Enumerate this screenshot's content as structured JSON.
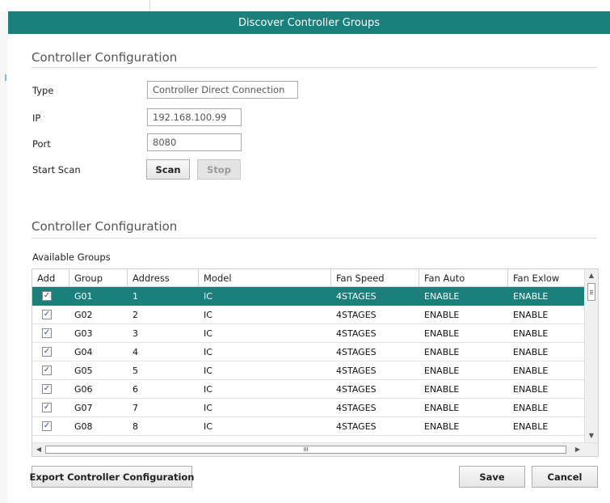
{
  "dialog": {
    "title": "Discover Controller Groups"
  },
  "config_section": {
    "title": "Controller Configuration",
    "type_label": "Type",
    "type_value": "Controller Direct Connection",
    "ip_label": "IP",
    "ip_value": "192.168.100.99",
    "port_label": "Port",
    "port_value": "8080",
    "scan_label": "Start Scan",
    "scan_button": "Scan",
    "stop_button": "Stop"
  },
  "groups_section": {
    "title": "Controller Configuration",
    "available_label": "Available Groups",
    "columns": [
      "Add",
      "Group",
      "Address",
      "Model",
      "Fan Speed",
      "Fan Auto",
      "Fan Exlow"
    ],
    "rows": [
      {
        "add": "✓",
        "group": "G01",
        "address": "1",
        "model": "IC",
        "fan_speed": "4STAGES",
        "fan_auto": "ENABLE",
        "fan_exlow": "ENABLE"
      },
      {
        "add": "✓",
        "group": "G02",
        "address": "2",
        "model": "IC",
        "fan_speed": "4STAGES",
        "fan_auto": "ENABLE",
        "fan_exlow": "ENABLE"
      },
      {
        "add": "✓",
        "group": "G03",
        "address": "3",
        "model": "IC",
        "fan_speed": "4STAGES",
        "fan_auto": "ENABLE",
        "fan_exlow": "ENABLE"
      },
      {
        "add": "✓",
        "group": "G04",
        "address": "4",
        "model": "IC",
        "fan_speed": "4STAGES",
        "fan_auto": "ENABLE",
        "fan_exlow": "ENABLE"
      },
      {
        "add": "✓",
        "group": "G05",
        "address": "5",
        "model": "IC",
        "fan_speed": "4STAGES",
        "fan_auto": "ENABLE",
        "fan_exlow": "ENABLE"
      },
      {
        "add": "✓",
        "group": "G06",
        "address": "6",
        "model": "IC",
        "fan_speed": "4STAGES",
        "fan_auto": "ENABLE",
        "fan_exlow": "ENABLE"
      },
      {
        "add": "✓",
        "group": "G07",
        "address": "7",
        "model": "IC",
        "fan_speed": "4STAGES",
        "fan_auto": "ENABLE",
        "fan_exlow": "ENABLE"
      },
      {
        "add": "✓",
        "group": "G08",
        "address": "8",
        "model": "IC",
        "fan_speed": "4STAGES",
        "fan_auto": "ENABLE",
        "fan_exlow": "ENABLE"
      }
    ],
    "selected_row": 0,
    "scroll_grip_glyph": "III"
  },
  "footer": {
    "export_button": "Export Controller Configuration",
    "save_button": "Save",
    "cancel_button": "Cancel"
  },
  "colors": {
    "accent": "#1b7f7b",
    "selected_row": "#1b7f7b",
    "checkbox_check": "#2b4f9c"
  }
}
